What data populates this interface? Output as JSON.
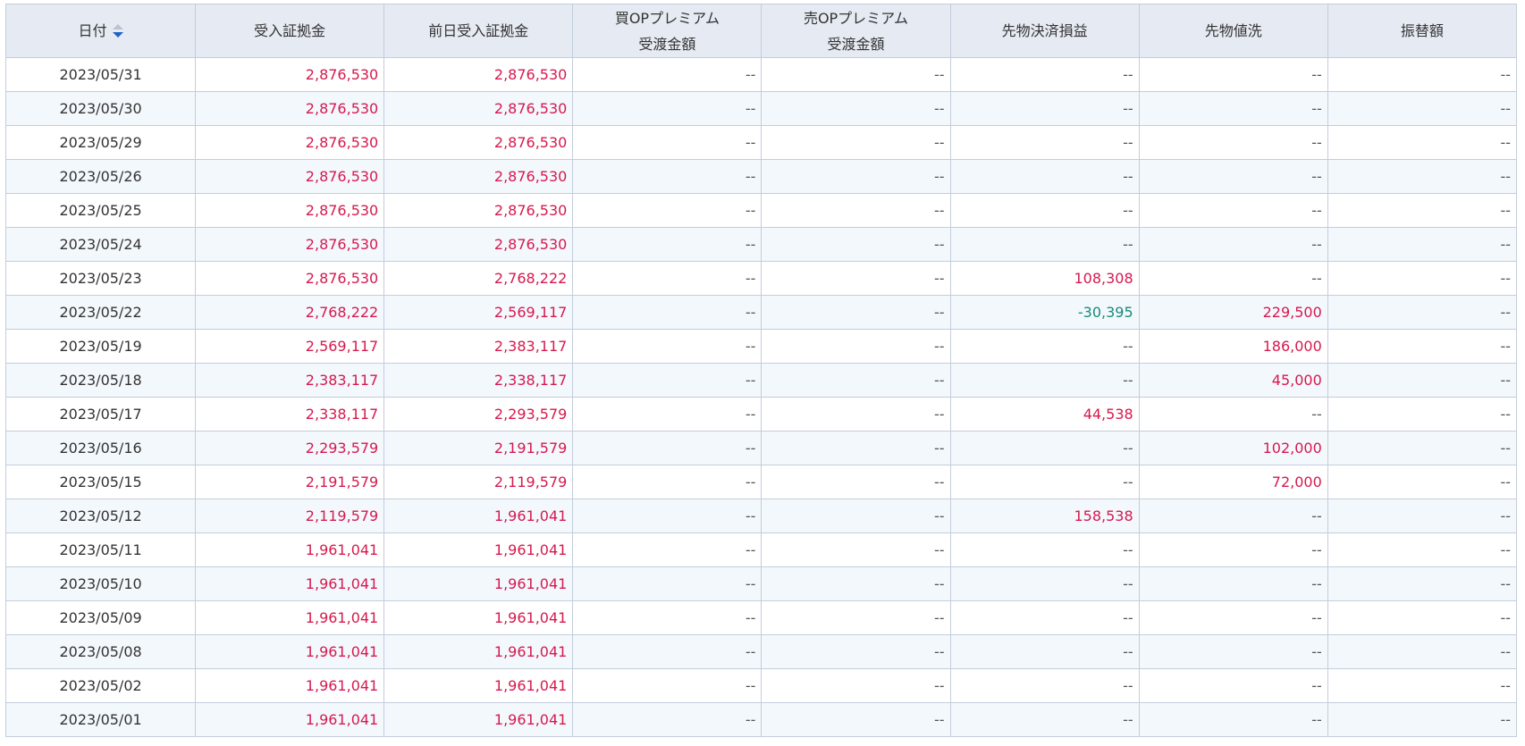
{
  "table": {
    "headers": [
      {
        "line1": "日付",
        "line2": ""
      },
      {
        "line1": "受入証拠金",
        "line2": ""
      },
      {
        "line1": "前日受入証拠金",
        "line2": ""
      },
      {
        "line1": "買OPプレミアム",
        "line2": "受渡金額"
      },
      {
        "line1": "売OPプレミアム",
        "line2": "受渡金額"
      },
      {
        "line1": "先物決済損益",
        "line2": ""
      },
      {
        "line1": "先物値洗",
        "line2": ""
      },
      {
        "line1": "振替額",
        "line2": ""
      }
    ],
    "sort_icon": "sort-desc-icon",
    "colors": {
      "positive": "#d6194e",
      "negative": "#1a8a7a",
      "header_bg": "#e6ebf3",
      "stripe_bg": "#f3f8fd"
    },
    "rows": [
      [
        "2023/05/31",
        "2,876,530",
        "2,876,530",
        "--",
        "--",
        "--",
        "--",
        "--"
      ],
      [
        "2023/05/30",
        "2,876,530",
        "2,876,530",
        "--",
        "--",
        "--",
        "--",
        "--"
      ],
      [
        "2023/05/29",
        "2,876,530",
        "2,876,530",
        "--",
        "--",
        "--",
        "--",
        "--"
      ],
      [
        "2023/05/26",
        "2,876,530",
        "2,876,530",
        "--",
        "--",
        "--",
        "--",
        "--"
      ],
      [
        "2023/05/25",
        "2,876,530",
        "2,876,530",
        "--",
        "--",
        "--",
        "--",
        "--"
      ],
      [
        "2023/05/24",
        "2,876,530",
        "2,876,530",
        "--",
        "--",
        "--",
        "--",
        "--"
      ],
      [
        "2023/05/23",
        "2,876,530",
        "2,768,222",
        "--",
        "--",
        "108,308",
        "--",
        "--"
      ],
      [
        "2023/05/22",
        "2,768,222",
        "2,569,117",
        "--",
        "--",
        "-30,395",
        "229,500",
        "--"
      ],
      [
        "2023/05/19",
        "2,569,117",
        "2,383,117",
        "--",
        "--",
        "--",
        "186,000",
        "--"
      ],
      [
        "2023/05/18",
        "2,383,117",
        "2,338,117",
        "--",
        "--",
        "--",
        "45,000",
        "--"
      ],
      [
        "2023/05/17",
        "2,338,117",
        "2,293,579",
        "--",
        "--",
        "44,538",
        "--",
        "--"
      ],
      [
        "2023/05/16",
        "2,293,579",
        "2,191,579",
        "--",
        "--",
        "--",
        "102,000",
        "--"
      ],
      [
        "2023/05/15",
        "2,191,579",
        "2,119,579",
        "--",
        "--",
        "--",
        "72,000",
        "--"
      ],
      [
        "2023/05/12",
        "2,119,579",
        "1,961,041",
        "--",
        "--",
        "158,538",
        "--",
        "--"
      ],
      [
        "2023/05/11",
        "1,961,041",
        "1,961,041",
        "--",
        "--",
        "--",
        "--",
        "--"
      ],
      [
        "2023/05/10",
        "1,961,041",
        "1,961,041",
        "--",
        "--",
        "--",
        "--",
        "--"
      ],
      [
        "2023/05/09",
        "1,961,041",
        "1,961,041",
        "--",
        "--",
        "--",
        "--",
        "--"
      ],
      [
        "2023/05/08",
        "1,961,041",
        "1,961,041",
        "--",
        "--",
        "--",
        "--",
        "--"
      ],
      [
        "2023/05/02",
        "1,961,041",
        "1,961,041",
        "--",
        "--",
        "--",
        "--",
        "--"
      ],
      [
        "2023/05/01",
        "1,961,041",
        "1,961,041",
        "--",
        "--",
        "--",
        "--",
        "--"
      ]
    ]
  }
}
